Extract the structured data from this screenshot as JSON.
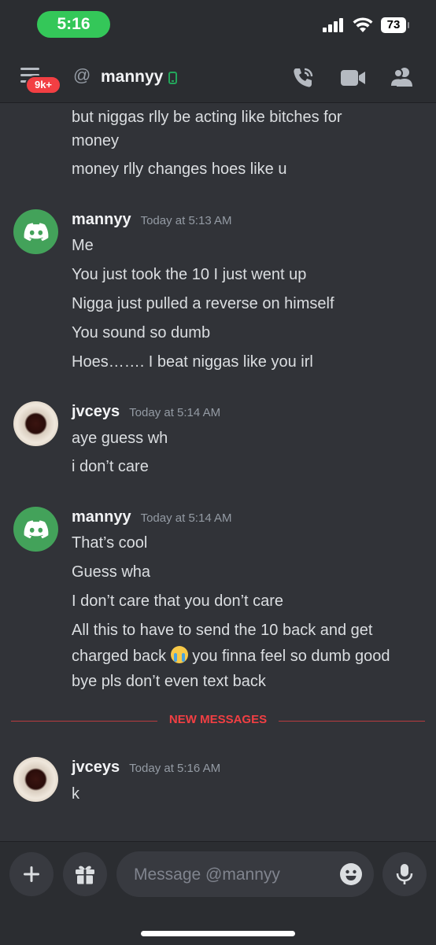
{
  "status_bar": {
    "time": "5:16",
    "battery": "73"
  },
  "header": {
    "badge": "9k+",
    "at_symbol": "@",
    "channel_name": "mannyy",
    "icons": [
      "menu-icon",
      "call-icon",
      "video-icon",
      "members-icon"
    ]
  },
  "messages": {
    "continuation_1": "but niggas rlly be acting like bitches for",
    "continuation_2": "money",
    "continuation_3": "money rlly changes hoes like u",
    "group1": {
      "author": "mannyy",
      "time": "Today at 5:13 AM",
      "lines": [
        "Me",
        "You just took the 10 I just went up",
        "Nigga just pulled a reverse on himself",
        "You sound so dumb",
        "Hoes……. I beat niggas like you irl"
      ]
    },
    "group2": {
      "author": "jvceys",
      "time": "Today at 5:14 AM",
      "lines": [
        "aye guess wh",
        "i don’t care"
      ]
    },
    "group3": {
      "author": "mannyy",
      "time": "Today at 5:14 AM",
      "lines": [
        "That’s cool",
        "Guess wha",
        "I don’t care that you don’t care",
        "All this to have to send the 10 back and get",
        "charged back",
        " you finna feel so dumb good",
        "bye pls don’t even text back"
      ]
    },
    "new_messages_label": "NEW MESSAGES",
    "group4": {
      "author": "jvceys",
      "time": "Today at 5:16 AM",
      "lines": [
        "k"
      ]
    }
  },
  "composer": {
    "placeholder": "Message @mannyy",
    "icons": [
      "plus-icon",
      "gift-icon",
      "emoji-icon",
      "microphone-icon"
    ]
  },
  "colors": {
    "background": "#313338",
    "header": "#2b2d31",
    "accent_red": "#f23f43",
    "online_green": "#23a55a",
    "discord_avatar": "#43a25a"
  }
}
